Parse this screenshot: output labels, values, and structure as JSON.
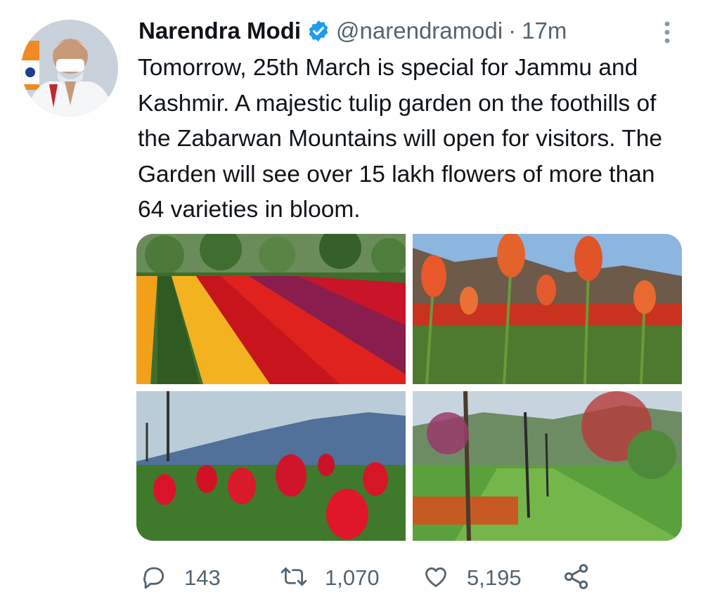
{
  "tweet": {
    "author_name": "Narendra Modi",
    "handle": "@narendramodi",
    "separator": "·",
    "time": "17m",
    "text": "Tomorrow, 25th March is special for Jammu and Kashmir. A majestic tulip garden on the foothills of the Zabarwan Mountains will open for visitors. The Garden will see over 15 lakh flowers of more than 64 varieties in bloom."
  },
  "actions": {
    "replies": "143",
    "retweets": "1,070",
    "likes": "5,195"
  },
  "icons": {
    "verified": "verified-badge-icon",
    "more": "more-vertical-icon",
    "reply": "reply-icon",
    "retweet": "retweet-icon",
    "like": "heart-icon",
    "share": "share-icon"
  },
  "colors": {
    "accent": "#1d9bf0",
    "text": "#0f1419",
    "secondary": "#536471"
  }
}
